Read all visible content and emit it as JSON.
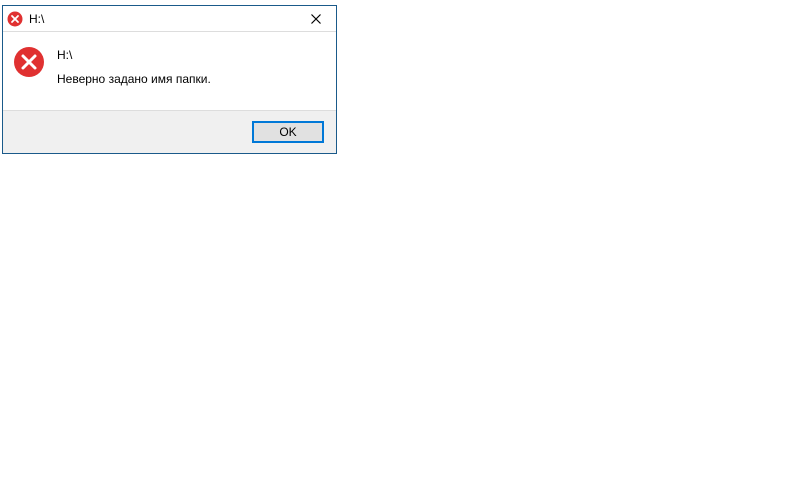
{
  "dialog": {
    "title": "H:\\",
    "heading": "H:\\",
    "message": "Неверно задано имя папки.",
    "ok_label": "OK"
  },
  "colors": {
    "error_red": "#e03131",
    "dialog_border": "#1a5a8a",
    "focus_blue": "#0078d7"
  }
}
